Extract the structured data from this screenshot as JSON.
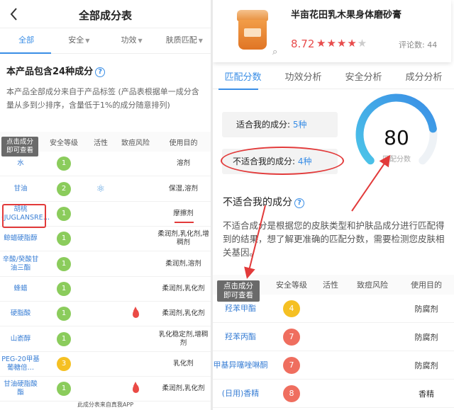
{
  "left": {
    "header_title": "全部成分表",
    "tabs": [
      {
        "label": "全部",
        "has_caret": false
      },
      {
        "label": "安全",
        "has_caret": true
      },
      {
        "label": "功效",
        "has_caret": true
      },
      {
        "label": "肤质匹配",
        "has_caret": true
      }
    ],
    "count_title": "本产品包含24种成分",
    "description": "本产品全部成分来自于产品标签 (产品表根据单一成分含量从多到少排序，含量低于1%的成分随意排列)",
    "tooltip": "点击成分即可查看",
    "columns": [
      "",
      "安全等级",
      "活性",
      "致痘风险",
      "使用目的"
    ],
    "rows": [
      {
        "name": "水",
        "level": "1",
        "color": "green",
        "active": false,
        "acne": false,
        "use": "溶剂"
      },
      {
        "name": "甘油",
        "level": "2",
        "color": "green",
        "active": true,
        "acne": false,
        "use": "保湿,溶剂"
      },
      {
        "name": "胡桃(JUGLANSRE…",
        "level": "1",
        "color": "green",
        "active": false,
        "acne": false,
        "use": "摩擦剂"
      },
      {
        "name": "鲸蜡硬脂醇",
        "level": "1",
        "color": "green",
        "active": false,
        "acne": false,
        "use": "柔润剂,乳化剂,增稠剂"
      },
      {
        "name": "辛酸/癸酸甘油三酯",
        "level": "1",
        "color": "green",
        "active": false,
        "acne": false,
        "use": "柔润剂,溶剂"
      },
      {
        "name": "蜂蜡",
        "level": "1",
        "color": "green",
        "active": false,
        "acne": false,
        "use": "柔润剂,乳化剂"
      },
      {
        "name": "硬脂酸",
        "level": "1",
        "color": "green",
        "active": false,
        "acne": true,
        "use": "柔润剂,乳化剂"
      },
      {
        "name": "山嵛醇",
        "level": "1",
        "color": "green",
        "active": false,
        "acne": false,
        "use": "乳化稳定剂,增稠剂"
      },
      {
        "name": "PEG-20甲基葡糖倍…",
        "level": "3",
        "color": "yellow",
        "active": false,
        "acne": false,
        "use": "乳化剂"
      },
      {
        "name": "甘油硬脂酸酯",
        "level": "1",
        "color": "green",
        "active": false,
        "acne": true,
        "use": "柔润剂,乳化剂"
      }
    ],
    "footer": "此成分表来自真我APP"
  },
  "right": {
    "product_name": "半亩花田乳木果身体磨砂膏",
    "rating": "8.72",
    "stars": "★★★★",
    "reviews_label": "评论数: 44",
    "tabs": [
      "匹配分数",
      "功效分析",
      "安全分析",
      "成分分析"
    ],
    "suitable_label": "适合我的成分:",
    "suitable_value": "5种",
    "unsuitable_label": "不适合我的成分:",
    "unsuitable_value": "4种",
    "match_score": "80",
    "match_label": "匹配分数",
    "unsuitable_heading": "不适合我的成分",
    "description": "不适合成分是根据您的皮肤类型和护肤品成分进行匹配得到的结果，想了解更准确的匹配分数，需要检测您皮肤相关基因。",
    "tooltip": "点击成分即可查看",
    "columns": [
      "",
      "安全等级",
      "活性",
      "致痘风险",
      "使用目的"
    ],
    "rows": [
      {
        "name": "羟苯甲酯",
        "level": "4",
        "color": "yellow",
        "use": "防腐剂"
      },
      {
        "name": "羟苯丙酯",
        "level": "7",
        "color": "red",
        "use": "防腐剂"
      },
      {
        "name": "甲基异噻唑啉酮",
        "level": "7",
        "color": "red",
        "use": "防腐剂"
      },
      {
        "name": "(日用)香精",
        "level": "8",
        "color": "red",
        "use": "香精"
      }
    ]
  },
  "colors": {
    "accent": "#3a8ee6",
    "green": "#8bcc5c",
    "yellow": "#f5c023",
    "red": "#ef6e5f",
    "annotation": "#e23a3a"
  },
  "gauge": {
    "value": 80,
    "max": 100
  }
}
